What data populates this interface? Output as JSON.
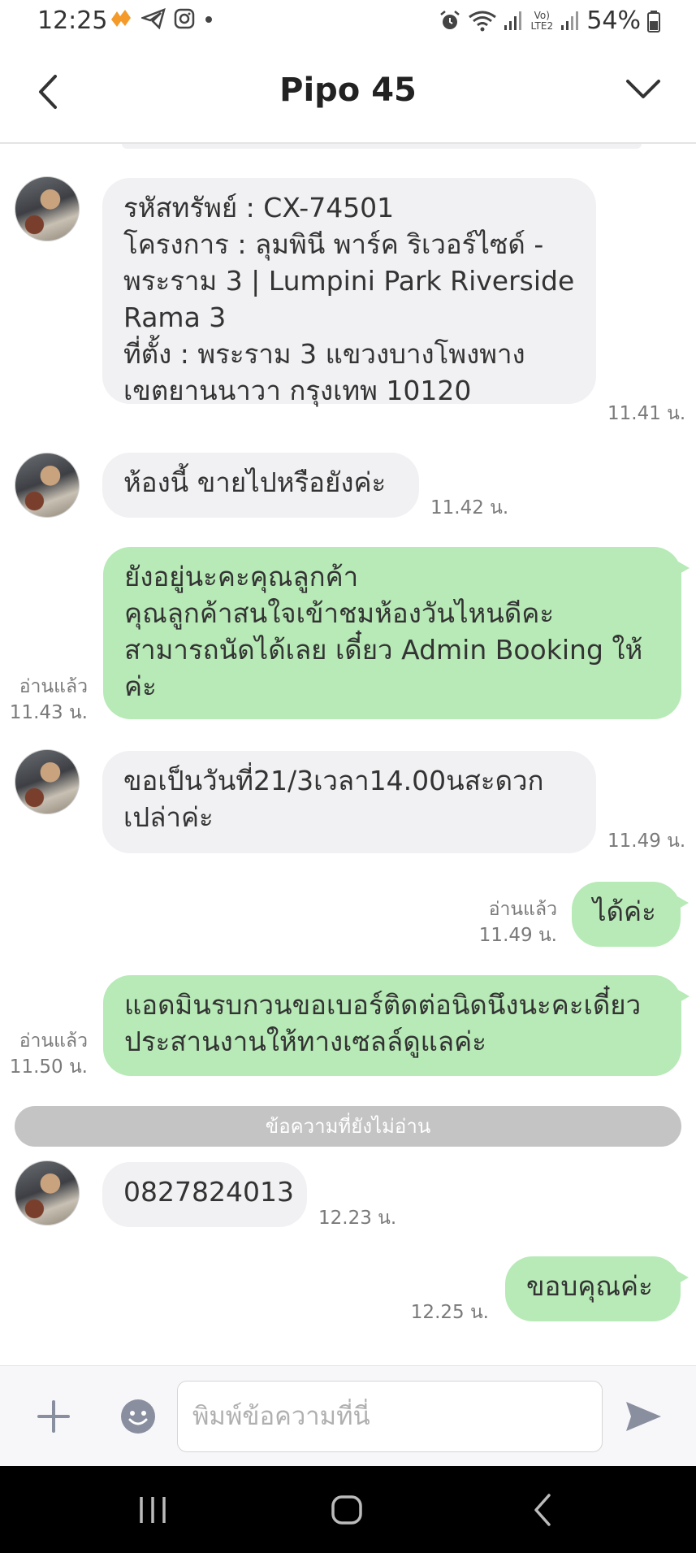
{
  "status_bar": {
    "time": "12:25",
    "battery": "54%",
    "signal_label": "Vo) LTE2"
  },
  "header": {
    "title": "Pipo 45"
  },
  "messages": [
    {
      "direction": "in",
      "lines": [
        "รหัสทรัพย์ : CX-74501",
        "โครงการ : ลุมพินี พาร์ค ริเวอร์ไซด์ -",
        "พระราม 3 | Lumpini Park Riverside",
        "Rama 3",
        "ที่ตั้ง :    พระราม 3 แขวงบางโพงพาง",
        "เขตยานนาวา กรุงเทพ 10120"
      ],
      "time": "11.41 น."
    },
    {
      "direction": "in",
      "lines": [
        "ห้องนี้ ขายไปหรือยังค่ะ"
      ],
      "time": "11.42 น."
    },
    {
      "direction": "out",
      "lines": [
        "ยังอยู่นะคะคุณลูกค้า",
        "คุณลูกค้าสนใจเข้าชมห้องวันไหนดีคะ",
        "สามารถนัดได้เลย เดี๋ยว Admin Booking ให้",
        "ค่ะ"
      ],
      "read": "อ่านแล้ว",
      "time": "11.43 น."
    },
    {
      "direction": "in",
      "lines": [
        "ขอเป็นวันที่21/3เวลา14.00นสะดวก",
        "เปล่าค่ะ"
      ],
      "time": "11.49 น."
    },
    {
      "direction": "out",
      "lines": [
        "ได้ค่ะ"
      ],
      "read": "อ่านแล้ว",
      "time": "11.49 น."
    },
    {
      "direction": "out",
      "lines": [
        "แอดมินรบกวนขอเบอร์ติดต่อนิดนึงนะคะเดี๋ยว",
        "ประสานงานให้ทางเซลล์ดูแลค่ะ"
      ],
      "read": "อ่านแล้ว",
      "time": "11.50 น."
    },
    {
      "direction": "in",
      "lines": [
        "0827824013"
      ],
      "time": "12.23 น."
    },
    {
      "direction": "out",
      "lines": [
        "ขอบคุณค่ะ"
      ],
      "time": "12.25 น."
    }
  ],
  "unread_divider": "ข้อความที่ยังไม่อ่าน",
  "input": {
    "placeholder": "พิมพ์ข้อความที่นี่"
  }
}
